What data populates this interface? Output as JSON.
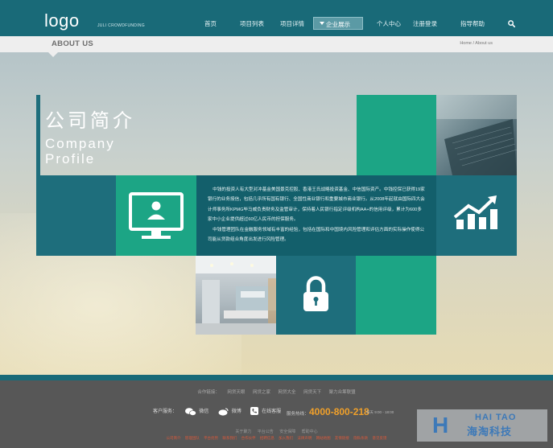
{
  "header": {
    "logo": "logo",
    "logo_sub": "JULI CROWDFUNDING",
    "nav": [
      "首页",
      "项目列表",
      "项目详情",
      "企业展示",
      "个人中心",
      "注册登录",
      "指导帮助"
    ],
    "active_index": 3
  },
  "subbar": {
    "title": "ABOUT US",
    "breadcrumb": [
      "Home",
      "About us"
    ]
  },
  "hero": {
    "title_cn": "公司简介",
    "title_en_line1": "Company",
    "title_en_line2": "Profile",
    "paragraphs": [
      "中钱的投资人有大型对冲基金美国景克控股、香港王氏战略投资基金、中信国际资产。中钱控保已获得19家银行的业务授信，包括几乎所有国有银行、全国性商业银行和重要城市商业银行。从2008年起就由国际四大会计师事务所KPMG毕马威负责财务及监管审计，保持着人民银行指定评级机构AA+的信用评级，累计为600多家中小企业提供超过60亿人民币的担保服务。",
      "中钱管理团队在金融服务领域有丰富的经验，包括在国际和中国境内风险管理和评估方面的实际操作使得公司能从贷款组合角度出发进行风险管理。"
    ]
  },
  "footer": {
    "links": [
      "合作链接：",
      "网贷天眼",
      "网贷之家",
      "网贷大全",
      "网贷天下",
      "聚力众筹联盟"
    ],
    "service_label": "客户服务：",
    "service_items": [
      "微信",
      "微博",
      "在线客服"
    ],
    "hotline_label": "服务热线：",
    "hotline": "4000-800-218",
    "hours": "每天 9:00 - 18:00",
    "links2": [
      "关于聚力",
      "平台公告",
      "安全保障",
      "帮助中心"
    ],
    "links3": [
      "公司简介",
      "管理团队",
      "平台优势",
      "联系我们",
      "合作伙伴",
      "招聘信息",
      "加入我们",
      "法律声明",
      "网站地图",
      "友情链接",
      "隐私条款",
      "意见反馈"
    ]
  },
  "watermark": {
    "en": "HAI TAO",
    "cn": "海淘科技",
    "mark": "H"
  },
  "colors": {
    "teal": "#1e6e7c",
    "green": "#1ca585",
    "hotline": "#f0a02a"
  },
  "icons": [
    "search-icon",
    "monitor-user-icon",
    "growth-chart-icon",
    "padlock-icon",
    "wechat-icon",
    "weibo-icon",
    "phone-icon"
  ]
}
